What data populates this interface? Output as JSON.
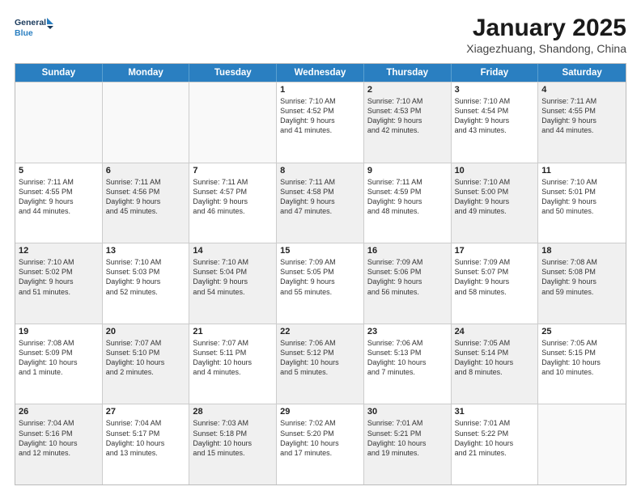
{
  "logo": {
    "line1": "General",
    "line2": "Blue"
  },
  "title": "January 2025",
  "subtitle": "Xiagezhuang, Shandong, China",
  "header_days": [
    "Sunday",
    "Monday",
    "Tuesday",
    "Wednesday",
    "Thursday",
    "Friday",
    "Saturday"
  ],
  "weeks": [
    [
      {
        "day": "",
        "info": "",
        "shaded": false,
        "empty": true
      },
      {
        "day": "",
        "info": "",
        "shaded": false,
        "empty": true
      },
      {
        "day": "",
        "info": "",
        "shaded": false,
        "empty": true
      },
      {
        "day": "1",
        "info": "Sunrise: 7:10 AM\nSunset: 4:52 PM\nDaylight: 9 hours\nand 41 minutes.",
        "shaded": false,
        "empty": false
      },
      {
        "day": "2",
        "info": "Sunrise: 7:10 AM\nSunset: 4:53 PM\nDaylight: 9 hours\nand 42 minutes.",
        "shaded": true,
        "empty": false
      },
      {
        "day": "3",
        "info": "Sunrise: 7:10 AM\nSunset: 4:54 PM\nDaylight: 9 hours\nand 43 minutes.",
        "shaded": false,
        "empty": false
      },
      {
        "day": "4",
        "info": "Sunrise: 7:11 AM\nSunset: 4:55 PM\nDaylight: 9 hours\nand 44 minutes.",
        "shaded": true,
        "empty": false
      }
    ],
    [
      {
        "day": "5",
        "info": "Sunrise: 7:11 AM\nSunset: 4:55 PM\nDaylight: 9 hours\nand 44 minutes.",
        "shaded": false,
        "empty": false
      },
      {
        "day": "6",
        "info": "Sunrise: 7:11 AM\nSunset: 4:56 PM\nDaylight: 9 hours\nand 45 minutes.",
        "shaded": true,
        "empty": false
      },
      {
        "day": "7",
        "info": "Sunrise: 7:11 AM\nSunset: 4:57 PM\nDaylight: 9 hours\nand 46 minutes.",
        "shaded": false,
        "empty": false
      },
      {
        "day": "8",
        "info": "Sunrise: 7:11 AM\nSunset: 4:58 PM\nDaylight: 9 hours\nand 47 minutes.",
        "shaded": true,
        "empty": false
      },
      {
        "day": "9",
        "info": "Sunrise: 7:11 AM\nSunset: 4:59 PM\nDaylight: 9 hours\nand 48 minutes.",
        "shaded": false,
        "empty": false
      },
      {
        "day": "10",
        "info": "Sunrise: 7:10 AM\nSunset: 5:00 PM\nDaylight: 9 hours\nand 49 minutes.",
        "shaded": true,
        "empty": false
      },
      {
        "day": "11",
        "info": "Sunrise: 7:10 AM\nSunset: 5:01 PM\nDaylight: 9 hours\nand 50 minutes.",
        "shaded": false,
        "empty": false
      }
    ],
    [
      {
        "day": "12",
        "info": "Sunrise: 7:10 AM\nSunset: 5:02 PM\nDaylight: 9 hours\nand 51 minutes.",
        "shaded": true,
        "empty": false
      },
      {
        "day": "13",
        "info": "Sunrise: 7:10 AM\nSunset: 5:03 PM\nDaylight: 9 hours\nand 52 minutes.",
        "shaded": false,
        "empty": false
      },
      {
        "day": "14",
        "info": "Sunrise: 7:10 AM\nSunset: 5:04 PM\nDaylight: 9 hours\nand 54 minutes.",
        "shaded": true,
        "empty": false
      },
      {
        "day": "15",
        "info": "Sunrise: 7:09 AM\nSunset: 5:05 PM\nDaylight: 9 hours\nand 55 minutes.",
        "shaded": false,
        "empty": false
      },
      {
        "day": "16",
        "info": "Sunrise: 7:09 AM\nSunset: 5:06 PM\nDaylight: 9 hours\nand 56 minutes.",
        "shaded": true,
        "empty": false
      },
      {
        "day": "17",
        "info": "Sunrise: 7:09 AM\nSunset: 5:07 PM\nDaylight: 9 hours\nand 58 minutes.",
        "shaded": false,
        "empty": false
      },
      {
        "day": "18",
        "info": "Sunrise: 7:08 AM\nSunset: 5:08 PM\nDaylight: 9 hours\nand 59 minutes.",
        "shaded": true,
        "empty": false
      }
    ],
    [
      {
        "day": "19",
        "info": "Sunrise: 7:08 AM\nSunset: 5:09 PM\nDaylight: 10 hours\nand 1 minute.",
        "shaded": false,
        "empty": false
      },
      {
        "day": "20",
        "info": "Sunrise: 7:07 AM\nSunset: 5:10 PM\nDaylight: 10 hours\nand 2 minutes.",
        "shaded": true,
        "empty": false
      },
      {
        "day": "21",
        "info": "Sunrise: 7:07 AM\nSunset: 5:11 PM\nDaylight: 10 hours\nand 4 minutes.",
        "shaded": false,
        "empty": false
      },
      {
        "day": "22",
        "info": "Sunrise: 7:06 AM\nSunset: 5:12 PM\nDaylight: 10 hours\nand 5 minutes.",
        "shaded": true,
        "empty": false
      },
      {
        "day": "23",
        "info": "Sunrise: 7:06 AM\nSunset: 5:13 PM\nDaylight: 10 hours\nand 7 minutes.",
        "shaded": false,
        "empty": false
      },
      {
        "day": "24",
        "info": "Sunrise: 7:05 AM\nSunset: 5:14 PM\nDaylight: 10 hours\nand 8 minutes.",
        "shaded": true,
        "empty": false
      },
      {
        "day": "25",
        "info": "Sunrise: 7:05 AM\nSunset: 5:15 PM\nDaylight: 10 hours\nand 10 minutes.",
        "shaded": false,
        "empty": false
      }
    ],
    [
      {
        "day": "26",
        "info": "Sunrise: 7:04 AM\nSunset: 5:16 PM\nDaylight: 10 hours\nand 12 minutes.",
        "shaded": true,
        "empty": false
      },
      {
        "day": "27",
        "info": "Sunrise: 7:04 AM\nSunset: 5:17 PM\nDaylight: 10 hours\nand 13 minutes.",
        "shaded": false,
        "empty": false
      },
      {
        "day": "28",
        "info": "Sunrise: 7:03 AM\nSunset: 5:18 PM\nDaylight: 10 hours\nand 15 minutes.",
        "shaded": true,
        "empty": false
      },
      {
        "day": "29",
        "info": "Sunrise: 7:02 AM\nSunset: 5:20 PM\nDaylight: 10 hours\nand 17 minutes.",
        "shaded": false,
        "empty": false
      },
      {
        "day": "30",
        "info": "Sunrise: 7:01 AM\nSunset: 5:21 PM\nDaylight: 10 hours\nand 19 minutes.",
        "shaded": true,
        "empty": false
      },
      {
        "day": "31",
        "info": "Sunrise: 7:01 AM\nSunset: 5:22 PM\nDaylight: 10 hours\nand 21 minutes.",
        "shaded": false,
        "empty": false
      },
      {
        "day": "",
        "info": "",
        "shaded": true,
        "empty": true
      }
    ]
  ]
}
